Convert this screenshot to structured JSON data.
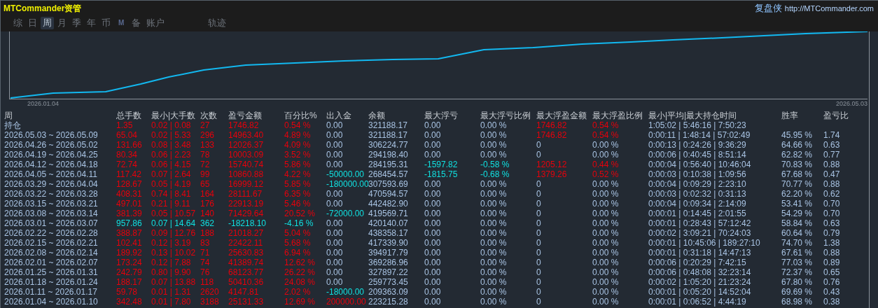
{
  "app": {
    "title": "MTCommander资管",
    "brand": "复盘侠",
    "url": "http://MTCommander.com"
  },
  "tabs": [
    {
      "label": "综",
      "kind": "word",
      "selected": false
    },
    {
      "label": "日",
      "kind": "word",
      "selected": false
    },
    {
      "label": "周",
      "kind": "word",
      "selected": true
    },
    {
      "label": "月",
      "kind": "word",
      "selected": false
    },
    {
      "label": "季",
      "kind": "word",
      "selected": false
    },
    {
      "label": "年",
      "kind": "word",
      "selected": false
    },
    {
      "label": "币",
      "kind": "word",
      "selected": false
    },
    {
      "label": "M",
      "kind": "letter",
      "selected": false
    },
    {
      "label": "备",
      "kind": "word",
      "selected": false
    },
    {
      "label": "账户",
      "kind": "word",
      "selected": false
    },
    {
      "label": "轨迹",
      "kind": "word",
      "selected": false
    }
  ],
  "chart": {
    "start_label": "2026.01.04",
    "end_label": "2026.05.03"
  },
  "table": {
    "columns": [
      "周",
      "总手数",
      "最小|大手数",
      "次数",
      "盈亏金额",
      "百分比%",
      "出入金",
      "余额",
      "最大浮亏",
      "最大浮亏比例",
      "最大浮盈金额",
      "最大浮盈比例",
      "最小|平均|最大持仓时间",
      "胜率",
      "盈亏比"
    ],
    "rows": [
      {
        "cells": [
          {
            "text": "持仓",
            "kind": "label"
          },
          {
            "text": "1.35",
            "kind": "gain"
          },
          {
            "text": "0.02 | 0.08",
            "kind": "gain"
          },
          {
            "text": "27",
            "kind": "gain"
          },
          {
            "text": "1746.82",
            "kind": "gain"
          },
          {
            "text": "0.54 %",
            "kind": "gain"
          },
          {
            "text": "0.00",
            "kind": "plain"
          },
          {
            "text": "321188.17",
            "kind": "plain"
          },
          {
            "text": "0.00",
            "kind": "plain"
          },
          {
            "text": "0.00 %",
            "kind": "plain"
          },
          {
            "text": "1746.82",
            "kind": "gain"
          },
          {
            "text": "0.54 %",
            "kind": "gain"
          },
          {
            "text": "1:05:02 | 5:46:16 | 7:50:23",
            "kind": "plain"
          }
        ]
      },
      {
        "cells": [
          {
            "text": "2026.05.03 ~ 2026.05.09",
            "kind": "label"
          },
          {
            "text": "65.04",
            "kind": "gain"
          },
          {
            "text": "0.02 | 5.33",
            "kind": "gain"
          },
          {
            "text": "296",
            "kind": "gain"
          },
          {
            "text": "14963.40",
            "kind": "gain"
          },
          {
            "text": "4.89 %",
            "kind": "gain"
          },
          {
            "text": "0.00",
            "kind": "plain"
          },
          {
            "text": "321188.17",
            "kind": "plain"
          },
          {
            "text": "0.00",
            "kind": "plain"
          },
          {
            "text": "0.00 %",
            "kind": "plain"
          },
          {
            "text": "1746.82",
            "kind": "gain"
          },
          {
            "text": "0.54 %",
            "kind": "gain"
          },
          {
            "text": "0:00:11 | 1:48:14 | 57:02:49",
            "kind": "plain"
          },
          {
            "text": "45.95 %",
            "kind": "plain"
          },
          {
            "text": "1.74",
            "kind": "plain"
          }
        ]
      },
      {
        "cells": [
          {
            "text": "2026.04.26 ~ 2026.05.02",
            "kind": "label"
          },
          {
            "text": "131.66",
            "kind": "gain"
          },
          {
            "text": "0.08 | 3.48",
            "kind": "gain"
          },
          {
            "text": "133",
            "kind": "gain"
          },
          {
            "text": "12026.37",
            "kind": "gain"
          },
          {
            "text": "4.09 %",
            "kind": "gain"
          },
          {
            "text": "0.00",
            "kind": "plain"
          },
          {
            "text": "306224.77",
            "kind": "plain"
          },
          {
            "text": "0.00",
            "kind": "plain"
          },
          {
            "text": "0.00 %",
            "kind": "plain"
          },
          {
            "text": "0",
            "kind": "plain"
          },
          {
            "text": "0.00 %",
            "kind": "plain"
          },
          {
            "text": "0:00:13 | 0:24:26 | 9:36:29",
            "kind": "plain"
          },
          {
            "text": "64.66 %",
            "kind": "plain"
          },
          {
            "text": "0.63",
            "kind": "plain"
          }
        ]
      },
      {
        "cells": [
          {
            "text": "2026.04.19 ~ 2026.04.25",
            "kind": "label"
          },
          {
            "text": "80.34",
            "kind": "gain"
          },
          {
            "text": "0.06 | 2.23",
            "kind": "gain"
          },
          {
            "text": "78",
            "kind": "gain"
          },
          {
            "text": "10003.09",
            "kind": "gain"
          },
          {
            "text": "3.52 %",
            "kind": "gain"
          },
          {
            "text": "0.00",
            "kind": "plain"
          },
          {
            "text": "294198.40",
            "kind": "plain"
          },
          {
            "text": "0.00",
            "kind": "plain"
          },
          {
            "text": "0.00 %",
            "kind": "plain"
          },
          {
            "text": "0",
            "kind": "plain"
          },
          {
            "text": "0.00 %",
            "kind": "plain"
          },
          {
            "text": "0:00:06 | 0:40:45 | 8:51:14",
            "kind": "plain"
          },
          {
            "text": "62.82 %",
            "kind": "plain"
          },
          {
            "text": "0.77",
            "kind": "plain"
          }
        ]
      },
      {
        "cells": [
          {
            "text": "2026.04.12 ~ 2026.04.18",
            "kind": "label"
          },
          {
            "text": "72.74",
            "kind": "gain"
          },
          {
            "text": "0.06 | 4.15",
            "kind": "gain"
          },
          {
            "text": "72",
            "kind": "gain"
          },
          {
            "text": "15740.74",
            "kind": "gain"
          },
          {
            "text": "5.86 %",
            "kind": "gain"
          },
          {
            "text": "0.00",
            "kind": "plain"
          },
          {
            "text": "284195.31",
            "kind": "plain"
          },
          {
            "text": "-1597.82",
            "kind": "loss"
          },
          {
            "text": "-0.58 %",
            "kind": "loss"
          },
          {
            "text": "1205.12",
            "kind": "gain"
          },
          {
            "text": "0.44 %",
            "kind": "gain"
          },
          {
            "text": "0:00:04 | 0:56:40 | 10:46:04",
            "kind": "plain"
          },
          {
            "text": "70.83 %",
            "kind": "plain"
          },
          {
            "text": "0.88",
            "kind": "plain"
          }
        ]
      },
      {
        "cells": [
          {
            "text": "2026.04.05 ~ 2026.04.11",
            "kind": "label"
          },
          {
            "text": "117.42",
            "kind": "gain"
          },
          {
            "text": "0.07 | 2.64",
            "kind": "gain"
          },
          {
            "text": "99",
            "kind": "gain"
          },
          {
            "text": "10860.88",
            "kind": "gain"
          },
          {
            "text": "4.22 %",
            "kind": "gain"
          },
          {
            "text": "-50000.00",
            "kind": "loss"
          },
          {
            "text": "268454.57",
            "kind": "plain"
          },
          {
            "text": "-1815.75",
            "kind": "loss"
          },
          {
            "text": "-0.68 %",
            "kind": "loss"
          },
          {
            "text": "1379.26",
            "kind": "gain"
          },
          {
            "text": "0.52 %",
            "kind": "gain"
          },
          {
            "text": "0:00:03 | 0:10:38 | 1:09:56",
            "kind": "plain"
          },
          {
            "text": "67.68 %",
            "kind": "plain"
          },
          {
            "text": "0.47",
            "kind": "plain"
          }
        ]
      },
      {
        "cells": [
          {
            "text": "2026.03.29 ~ 2026.04.04",
            "kind": "label"
          },
          {
            "text": "128.67",
            "kind": "gain"
          },
          {
            "text": "0.05 | 4.19",
            "kind": "gain"
          },
          {
            "text": "65",
            "kind": "gain"
          },
          {
            "text": "16999.12",
            "kind": "gain"
          },
          {
            "text": "5.85 %",
            "kind": "gain"
          },
          {
            "text": "-180000.00",
            "kind": "loss"
          },
          {
            "text": "307593.69",
            "kind": "plain"
          },
          {
            "text": "0.00",
            "kind": "plain"
          },
          {
            "text": "0.00 %",
            "kind": "plain"
          },
          {
            "text": "0",
            "kind": "plain"
          },
          {
            "text": "0.00 %",
            "kind": "plain"
          },
          {
            "text": "0:00:04 | 0:09:29 | 2:23:10",
            "kind": "plain"
          },
          {
            "text": "70.77 %",
            "kind": "plain"
          },
          {
            "text": "0.88",
            "kind": "plain"
          }
        ]
      },
      {
        "cells": [
          {
            "text": "2026.03.22 ~ 2026.03.28",
            "kind": "label"
          },
          {
            "text": "408.31",
            "kind": "gain"
          },
          {
            "text": "0.74 | 8.41",
            "kind": "gain"
          },
          {
            "text": "164",
            "kind": "gain"
          },
          {
            "text": "28111.67",
            "kind": "gain"
          },
          {
            "text": "6.35 %",
            "kind": "gain"
          },
          {
            "text": "0.00",
            "kind": "plain"
          },
          {
            "text": "470594.57",
            "kind": "plain"
          },
          {
            "text": "0.00",
            "kind": "plain"
          },
          {
            "text": "0.00 %",
            "kind": "plain"
          },
          {
            "text": "0",
            "kind": "plain"
          },
          {
            "text": "0.00 %",
            "kind": "plain"
          },
          {
            "text": "0:00:03 | 0:02:32 | 0:31:13",
            "kind": "plain"
          },
          {
            "text": "62.20 %",
            "kind": "plain"
          },
          {
            "text": "0.62",
            "kind": "plain"
          }
        ]
      },
      {
        "cells": [
          {
            "text": "2026.03.15 ~ 2026.03.21",
            "kind": "label"
          },
          {
            "text": "497.01",
            "kind": "gain"
          },
          {
            "text": "0.21 | 9.11",
            "kind": "gain"
          },
          {
            "text": "176",
            "kind": "gain"
          },
          {
            "text": "22913.19",
            "kind": "gain"
          },
          {
            "text": "5.46 %",
            "kind": "gain"
          },
          {
            "text": "0.00",
            "kind": "plain"
          },
          {
            "text": "442482.90",
            "kind": "plain"
          },
          {
            "text": "0.00",
            "kind": "plain"
          },
          {
            "text": "0.00 %",
            "kind": "plain"
          },
          {
            "text": "0",
            "kind": "plain"
          },
          {
            "text": "0.00 %",
            "kind": "plain"
          },
          {
            "text": "0:00:04 | 0:09:34 | 2:14:09",
            "kind": "plain"
          },
          {
            "text": "53.41 %",
            "kind": "plain"
          },
          {
            "text": "0.70",
            "kind": "plain"
          }
        ]
      },
      {
        "cells": [
          {
            "text": "2026.03.08 ~ 2026.03.14",
            "kind": "label"
          },
          {
            "text": "381.39",
            "kind": "gain"
          },
          {
            "text": "0.05 | 10.57",
            "kind": "gain"
          },
          {
            "text": "140",
            "kind": "gain"
          },
          {
            "text": "71429.64",
            "kind": "gain"
          },
          {
            "text": "20.52 %",
            "kind": "gain"
          },
          {
            "text": "-72000.00",
            "kind": "loss"
          },
          {
            "text": "419569.71",
            "kind": "plain"
          },
          {
            "text": "0.00",
            "kind": "plain"
          },
          {
            "text": "0.00 %",
            "kind": "plain"
          },
          {
            "text": "0",
            "kind": "plain"
          },
          {
            "text": "0.00 %",
            "kind": "plain"
          },
          {
            "text": "0:00:01 | 0:14:45 | 2:01:55",
            "kind": "plain"
          },
          {
            "text": "54.29 %",
            "kind": "plain"
          },
          {
            "text": "0.70",
            "kind": "plain"
          }
        ]
      },
      {
        "cells": [
          {
            "text": "2026.03.01 ~ 2026.03.07",
            "kind": "label"
          },
          {
            "text": "957.86",
            "kind": "loss"
          },
          {
            "text": "0.07 | 14.64",
            "kind": "loss"
          },
          {
            "text": "362",
            "kind": "loss"
          },
          {
            "text": "-18218.10",
            "kind": "loss"
          },
          {
            "text": "-4.16 %",
            "kind": "loss"
          },
          {
            "text": "0.00",
            "kind": "plain"
          },
          {
            "text": "420140.07",
            "kind": "plain"
          },
          {
            "text": "0.00",
            "kind": "plain"
          },
          {
            "text": "0.00 %",
            "kind": "plain"
          },
          {
            "text": "0",
            "kind": "plain"
          },
          {
            "text": "0.00 %",
            "kind": "plain"
          },
          {
            "text": "0:00:01 | 0:28:43 | 57:12:42",
            "kind": "plain"
          },
          {
            "text": "58.84 %",
            "kind": "plain"
          },
          {
            "text": "0.63",
            "kind": "plain"
          }
        ]
      },
      {
        "cells": [
          {
            "text": "2026.02.22 ~ 2026.02.28",
            "kind": "label"
          },
          {
            "text": "388.87",
            "kind": "gain"
          },
          {
            "text": "0.09 | 12.76",
            "kind": "gain"
          },
          {
            "text": "188",
            "kind": "gain"
          },
          {
            "text": "21018.27",
            "kind": "gain"
          },
          {
            "text": "5.04 %",
            "kind": "gain"
          },
          {
            "text": "0.00",
            "kind": "plain"
          },
          {
            "text": "438358.17",
            "kind": "plain"
          },
          {
            "text": "0.00",
            "kind": "plain"
          },
          {
            "text": "0.00 %",
            "kind": "plain"
          },
          {
            "text": "0",
            "kind": "plain"
          },
          {
            "text": "0.00 %",
            "kind": "plain"
          },
          {
            "text": "0:00:02 | 3:09:21 | 70:24:03",
            "kind": "plain"
          },
          {
            "text": "60.64 %",
            "kind": "plain"
          },
          {
            "text": "0.79",
            "kind": "plain"
          }
        ]
      },
      {
        "cells": [
          {
            "text": "2026.02.15 ~ 2026.02.21",
            "kind": "label"
          },
          {
            "text": "102.41",
            "kind": "gain"
          },
          {
            "text": "0.12 | 3.19",
            "kind": "gain"
          },
          {
            "text": "83",
            "kind": "gain"
          },
          {
            "text": "22422.11",
            "kind": "gain"
          },
          {
            "text": "5.68 %",
            "kind": "gain"
          },
          {
            "text": "0.00",
            "kind": "plain"
          },
          {
            "text": "417339.90",
            "kind": "plain"
          },
          {
            "text": "0.00",
            "kind": "plain"
          },
          {
            "text": "0.00 %",
            "kind": "plain"
          },
          {
            "text": "0",
            "kind": "plain"
          },
          {
            "text": "0.00 %",
            "kind": "plain"
          },
          {
            "text": "0:00:01 | 10:45:06 | 189:27:10",
            "kind": "plain"
          },
          {
            "text": "74.70 %",
            "kind": "plain"
          },
          {
            "text": "1.38",
            "kind": "plain"
          }
        ]
      },
      {
        "cells": [
          {
            "text": "2026.02.08 ~ 2026.02.14",
            "kind": "label"
          },
          {
            "text": "189.92",
            "kind": "gain"
          },
          {
            "text": "0.13 | 10.02",
            "kind": "gain"
          },
          {
            "text": "71",
            "kind": "gain"
          },
          {
            "text": "25630.83",
            "kind": "gain"
          },
          {
            "text": "6.94 %",
            "kind": "gain"
          },
          {
            "text": "0.00",
            "kind": "plain"
          },
          {
            "text": "394917.79",
            "kind": "plain"
          },
          {
            "text": "0.00",
            "kind": "plain"
          },
          {
            "text": "0.00 %",
            "kind": "plain"
          },
          {
            "text": "0",
            "kind": "plain"
          },
          {
            "text": "0.00 %",
            "kind": "plain"
          },
          {
            "text": "0:00:01 | 0:31:18 | 14:47:13",
            "kind": "plain"
          },
          {
            "text": "67.61 %",
            "kind": "plain"
          },
          {
            "text": "0.88",
            "kind": "plain"
          }
        ]
      },
      {
        "cells": [
          {
            "text": "2026.02.01 ~ 2026.02.07",
            "kind": "label"
          },
          {
            "text": "173.24",
            "kind": "gain"
          },
          {
            "text": "0.12 | 7.88",
            "kind": "gain"
          },
          {
            "text": "74",
            "kind": "gain"
          },
          {
            "text": "41389.74",
            "kind": "gain"
          },
          {
            "text": "12.62 %",
            "kind": "gain"
          },
          {
            "text": "0.00",
            "kind": "plain"
          },
          {
            "text": "369286.96",
            "kind": "plain"
          },
          {
            "text": "0.00",
            "kind": "plain"
          },
          {
            "text": "0.00 %",
            "kind": "plain"
          },
          {
            "text": "0",
            "kind": "plain"
          },
          {
            "text": "0.00 %",
            "kind": "plain"
          },
          {
            "text": "0:00:06 | 0:20:29 | 7:42:15",
            "kind": "plain"
          },
          {
            "text": "77.03 %",
            "kind": "plain"
          },
          {
            "text": "0.89",
            "kind": "plain"
          }
        ]
      },
      {
        "cells": [
          {
            "text": "2026.01.25 ~ 2026.01.31",
            "kind": "label"
          },
          {
            "text": "242.79",
            "kind": "gain"
          },
          {
            "text": "0.80 | 9.90",
            "kind": "gain"
          },
          {
            "text": "76",
            "kind": "gain"
          },
          {
            "text": "68123.77",
            "kind": "gain"
          },
          {
            "text": "26.22 %",
            "kind": "gain"
          },
          {
            "text": "0.00",
            "kind": "plain"
          },
          {
            "text": "327897.22",
            "kind": "plain"
          },
          {
            "text": "0.00",
            "kind": "plain"
          },
          {
            "text": "0.00 %",
            "kind": "plain"
          },
          {
            "text": "0",
            "kind": "plain"
          },
          {
            "text": "0.00 %",
            "kind": "plain"
          },
          {
            "text": "0:00:06 | 0:48:08 | 32:23:14",
            "kind": "plain"
          },
          {
            "text": "72.37 %",
            "kind": "plain"
          },
          {
            "text": "0.65",
            "kind": "plain"
          }
        ]
      },
      {
        "cells": [
          {
            "text": "2026.01.18 ~ 2026.01.24",
            "kind": "label"
          },
          {
            "text": "188.17",
            "kind": "gain"
          },
          {
            "text": "0.07 | 13.88",
            "kind": "gain"
          },
          {
            "text": "118",
            "kind": "gain"
          },
          {
            "text": "50410.36",
            "kind": "gain"
          },
          {
            "text": "24.08 %",
            "kind": "gain"
          },
          {
            "text": "0.00",
            "kind": "plain"
          },
          {
            "text": "259773.45",
            "kind": "plain"
          },
          {
            "text": "0.00",
            "kind": "plain"
          },
          {
            "text": "0.00 %",
            "kind": "plain"
          },
          {
            "text": "0",
            "kind": "plain"
          },
          {
            "text": "0.00 %",
            "kind": "plain"
          },
          {
            "text": "0:00:02 | 1:05:20 | 21:23:24",
            "kind": "plain"
          },
          {
            "text": "67.80 %",
            "kind": "plain"
          },
          {
            "text": "0.76",
            "kind": "plain"
          }
        ]
      },
      {
        "cells": [
          {
            "text": "2026.01.11 ~ 2026.01.17",
            "kind": "label"
          },
          {
            "text": "59.78",
            "kind": "gain"
          },
          {
            "text": "0.01 | 1.31",
            "kind": "gain"
          },
          {
            "text": "2620",
            "kind": "gain"
          },
          {
            "text": "4147.81",
            "kind": "gain"
          },
          {
            "text": "2.02 %",
            "kind": "gain"
          },
          {
            "text": "-18000.00",
            "kind": "loss"
          },
          {
            "text": "209363.09",
            "kind": "plain"
          },
          {
            "text": "0.00",
            "kind": "plain"
          },
          {
            "text": "0.00 %",
            "kind": "plain"
          },
          {
            "text": "0",
            "kind": "plain"
          },
          {
            "text": "0.00 %",
            "kind": "plain"
          },
          {
            "text": "0:00:01 | 0:05:20 | 14:52:04",
            "kind": "plain"
          },
          {
            "text": "69.69 %",
            "kind": "plain"
          },
          {
            "text": "0.43",
            "kind": "plain"
          }
        ]
      },
      {
        "cells": [
          {
            "text": "2026.01.04 ~ 2026.01.10",
            "kind": "label"
          },
          {
            "text": "342.48",
            "kind": "gain"
          },
          {
            "text": "0.01 | 7.80",
            "kind": "gain"
          },
          {
            "text": "3188",
            "kind": "gain"
          },
          {
            "text": "25131.33",
            "kind": "gain"
          },
          {
            "text": "12.69 %",
            "kind": "gain"
          },
          {
            "text": "200000.00",
            "kind": "gain"
          },
          {
            "text": "223215.28",
            "kind": "plain"
          },
          {
            "text": "0.00",
            "kind": "plain"
          },
          {
            "text": "0.00 %",
            "kind": "plain"
          },
          {
            "text": "0",
            "kind": "plain"
          },
          {
            "text": "0.00 %",
            "kind": "plain"
          },
          {
            "text": "0:00:01 | 0:06:52 | 4:44:19",
            "kind": "plain"
          },
          {
            "text": "68.98 %",
            "kind": "plain"
          },
          {
            "text": "0.38",
            "kind": "plain"
          }
        ]
      }
    ]
  }
}
